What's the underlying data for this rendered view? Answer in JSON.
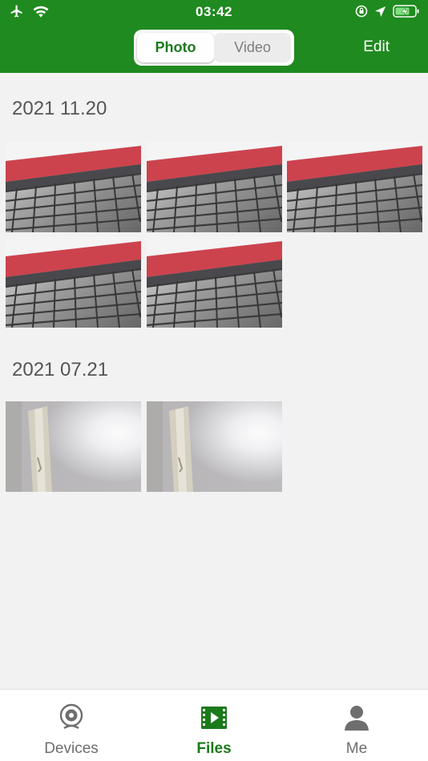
{
  "status_bar": {
    "time": "03:42",
    "left_icons": [
      "airplane-icon",
      "wifi-icon"
    ],
    "right_icons": [
      "orientation-lock-icon",
      "location-icon",
      "battery-charging-icon"
    ]
  },
  "header": {
    "segments": [
      {
        "label": "Photo",
        "selected": true
      },
      {
        "label": "Video",
        "selected": false
      }
    ],
    "edit_label": "Edit",
    "accent_color": "#1f8a1f"
  },
  "sections": [
    {
      "date": "2021 11.20",
      "photo_count": 5,
      "thumbnail_scene": "red-canopy-grille"
    },
    {
      "date": "2021 07.21",
      "photo_count": 2,
      "thumbnail_scene": "blurry-bright-wall"
    }
  ],
  "tabs": [
    {
      "label": "Devices",
      "icon": "camera-icon",
      "active": false
    },
    {
      "label": "Files",
      "icon": "film-strip-icon",
      "active": true
    },
    {
      "label": "Me",
      "icon": "person-icon",
      "active": false
    }
  ]
}
